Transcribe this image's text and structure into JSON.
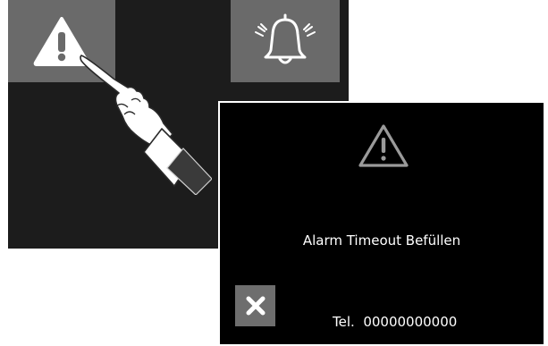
{
  "background_panel": {
    "tiles": [
      {
        "icon": "warning-triangle-icon"
      },
      {
        "icon": "ringing-bell-icon"
      }
    ],
    "pointer": {
      "icon": "pointing-hand-icon"
    }
  },
  "alarm_popup": {
    "icon": "warning-triangle-icon",
    "message": "Alarm Timeout Befüllen",
    "close_icon": "close-x-icon",
    "tel_label": "Tel.",
    "tel_number": "00000000000"
  },
  "colors": {
    "screen_bg": "#1c1c1c",
    "tile_bg": "#6a6a6a",
    "popup_bg": "#000000",
    "popup_border": "#ffffff",
    "text": "#ffffff"
  }
}
